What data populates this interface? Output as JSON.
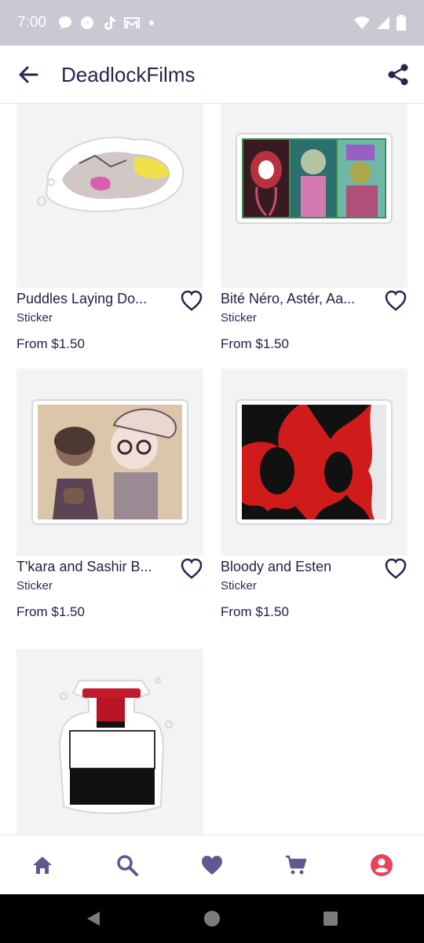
{
  "status_bar": {
    "time": "7:00",
    "notification_icons": [
      "chat-bubble-icon",
      "messenger-icon",
      "tiktok-icon",
      "gmail-icon",
      "dot-icon"
    ],
    "system_icons": [
      "wifi-icon",
      "signal-icon",
      "battery-icon"
    ]
  },
  "app_bar": {
    "title": "DeadlockFilms",
    "back_icon": "arrow-back-icon",
    "share_icon": "share-icon"
  },
  "products": [
    {
      "name": "Puddles Laying Do...",
      "type": "Sticker",
      "price": "From $1.50"
    },
    {
      "name": "Bité Néro, Astér, Aa...",
      "type": "Sticker",
      "price": "From $1.50"
    },
    {
      "name": "T'kara and Sashir B...",
      "type": "Sticker",
      "price": "From $1.50"
    },
    {
      "name": "Bloody and Esten",
      "type": "Sticker",
      "price": "From $1.50"
    }
  ],
  "bottom_nav": {
    "items": [
      "home-icon",
      "search-icon",
      "heart-icon",
      "cart-icon",
      "account-icon"
    ],
    "active": "account-icon"
  },
  "colors": {
    "accent": "#e8435a",
    "nav_icon": "#5e5990",
    "title_text": "#272450",
    "status_bar": "#c9c8d3"
  }
}
